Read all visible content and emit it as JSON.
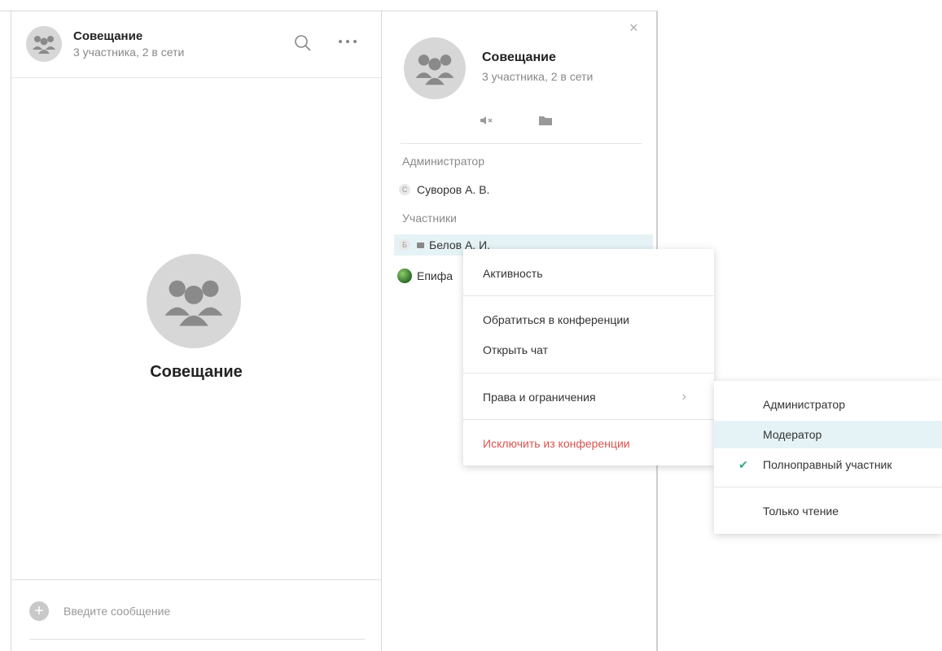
{
  "chat": {
    "title": "Совещание",
    "subtitle": "3 участника, 2 в сети",
    "center_title": "Совещание",
    "composer_placeholder": "Введите сообщение",
    "plus_label": "+"
  },
  "info": {
    "title": "Совещание",
    "subtitle": "3 участника, 2 в сети",
    "close_label": "×",
    "admin_section": "Администратор",
    "members_section": "Участники",
    "admins": [
      {
        "initial": "С",
        "name": "Суворов А. В."
      }
    ],
    "members": [
      {
        "initial": "Б",
        "name": "Белов А. И.",
        "highlighted": true
      },
      {
        "initial": "",
        "name": "Епифа",
        "has_photo": true
      }
    ]
  },
  "context_menu": {
    "items": [
      {
        "label": "Активность"
      },
      {
        "label": "Обратиться в конференции"
      },
      {
        "label": "Открыть чат"
      },
      {
        "label": "Права и ограничения",
        "has_submenu": true
      },
      {
        "label": "Исключить из конференции",
        "danger": true
      }
    ],
    "chevron": "›"
  },
  "submenu": {
    "items": [
      {
        "label": "Администратор"
      },
      {
        "label": "Модератор",
        "highlighted": true
      },
      {
        "label": "Полноправный участник",
        "checked": true
      },
      {
        "label": "Только чтение"
      }
    ],
    "check_glyph": "✔"
  },
  "colors": {
    "accent_check": "#33a88a",
    "danger": "#d9534f",
    "highlight": "#e6f3f6",
    "avatar_bg": "#d7d7d7"
  },
  "icons": {
    "header": [
      "group-avatar-icon",
      "search-icon",
      "more-dots-icon"
    ],
    "info_actions": [
      "mute-icon",
      "folder-icon"
    ]
  }
}
